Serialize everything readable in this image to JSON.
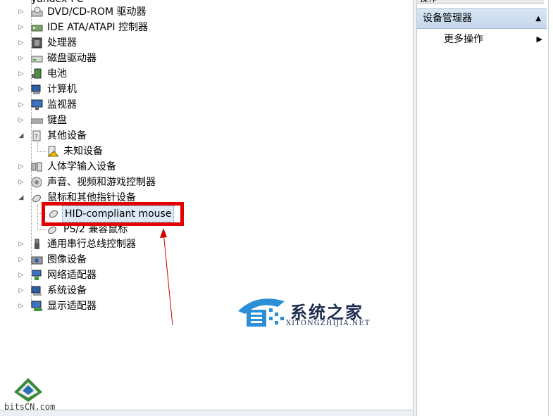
{
  "tree": {
    "top_partial": "yandex-PC",
    "items": [
      {
        "label": "DVD/CD-ROM 驱动器",
        "icon": "dvd-drive-icon"
      },
      {
        "label": "IDE ATA/ATAPI 控制器",
        "icon": "ide-controller-icon"
      },
      {
        "label": "处理器",
        "icon": "processor-icon"
      },
      {
        "label": "磁盘驱动器",
        "icon": "disk-drive-icon"
      },
      {
        "label": "电池",
        "icon": "battery-icon"
      },
      {
        "label": "计算机",
        "icon": "computer-icon"
      },
      {
        "label": "监视器",
        "icon": "monitor-icon"
      },
      {
        "label": "键盘",
        "icon": "keyboard-icon"
      },
      {
        "label": "其他设备",
        "icon": "other-devices-icon"
      },
      {
        "label": "未知设备",
        "icon": "unknown-device-warning-icon"
      },
      {
        "label": "人体学输入设备",
        "icon": "hid-icon"
      },
      {
        "label": "声音、视频和游戏控制器",
        "icon": "sound-icon"
      },
      {
        "label": "鼠标和其他指针设备",
        "icon": "mouse-icon"
      },
      {
        "label": "HID-compliant mouse",
        "icon": "mouse-icon"
      },
      {
        "label": "PS/2 兼容鼠标",
        "icon": "mouse-icon"
      },
      {
        "label": "通用串行总线控制器",
        "icon": "usb-icon"
      },
      {
        "label": "图像设备",
        "icon": "camera-icon"
      },
      {
        "label": "网络适配器",
        "icon": "network-adapter-icon"
      },
      {
        "label": "系统设备",
        "icon": "system-device-icon"
      },
      {
        "label": "显示适配器",
        "icon": "display-adapter-icon"
      }
    ]
  },
  "actions": {
    "title": "操作",
    "section": "设备管理器",
    "more": "更多操作"
  },
  "watermark": {
    "cn": "系统之家",
    "en": "XITONGZHIJIA.NET"
  },
  "logo": {
    "text": "bitsCN.com"
  },
  "colors": {
    "highlight": "#e00000",
    "arrow": "#cc0000",
    "selection": "#dce9f7",
    "action_header": "#c4d7ec"
  }
}
